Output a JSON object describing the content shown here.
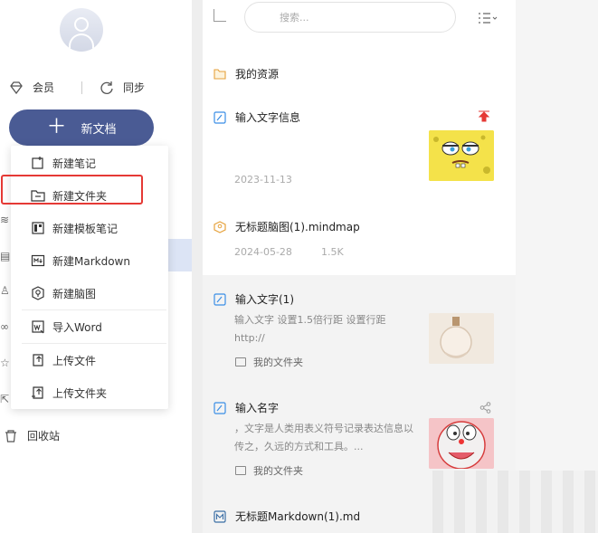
{
  "sidebar": {
    "member_label": "会员",
    "sync_label": "同步",
    "new_doc_label": "新文档",
    "recycle_label": "回收站"
  },
  "menu": {
    "items": [
      {
        "label": "新建笔记",
        "icon": "new-note-icon"
      },
      {
        "label": "新建文件夹",
        "icon": "new-folder-icon"
      },
      {
        "label": "新建模板笔记",
        "icon": "template-note-icon"
      },
      {
        "label": "新建Markdown",
        "icon": "markdown-icon"
      },
      {
        "label": "新建脑图",
        "icon": "mindmap-icon"
      },
      {
        "label": "导入Word",
        "icon": "import-word-icon"
      },
      {
        "label": "上传文件",
        "icon": "upload-file-icon"
      },
      {
        "label": "上传文件夹",
        "icon": "upload-folder-icon"
      }
    ],
    "highlighted_index": 1,
    "highlight_color": "#e53935"
  },
  "toolbar": {
    "search_placeholder": "搜索..."
  },
  "list": {
    "folder": {
      "title": "我的资源"
    },
    "items": [
      {
        "title": "输入文字信息",
        "date": "2023-11-13",
        "pinned": true
      },
      {
        "title": "无标题脑图(1).mindmap",
        "date": "2024-05-28",
        "size": "1.5K"
      },
      {
        "title": "输入文字(1)",
        "desc": "输入文字 设置1.5倍行距 设置行距 http://",
        "folder": "我的文件夹"
      },
      {
        "title": "输入名字",
        "desc": "，文字是人类用表义符号记录表达信息以传之，久远的方式和工具。...",
        "folder": "我的文件夹"
      },
      {
        "title": "无标题Markdown(1).md"
      }
    ]
  },
  "colors": {
    "accent": "#4a5b94",
    "pin_red": "#e53935",
    "doc_icon": "#3a8ee6",
    "mindmap_icon": "#e6a23c"
  }
}
